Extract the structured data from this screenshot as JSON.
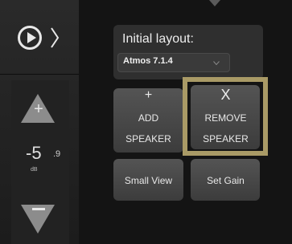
{
  "volume": {
    "value_main": "-5",
    "value_decimal": ".9",
    "unit": "dB",
    "up_icon": "plus-icon",
    "down_icon": "minus-icon"
  },
  "player": {
    "play_icon": "play-circle-icon",
    "chevron_icon": "chevron-right-icon"
  },
  "layout": {
    "label": "Initial layout:",
    "selected": "Atmos 7.1.4"
  },
  "buttons": {
    "add_symbol": "+",
    "add_line1": "ADD",
    "add_line2": "SPEAKER",
    "remove_symbol": "X",
    "remove_line1": "REMOVE",
    "remove_line2": "SPEAKER",
    "small_view": "Small View",
    "set_gain": "Set Gain"
  },
  "colors": {
    "highlight_frame": "#a99a66",
    "background": "#141414",
    "tile": "#4a4a4a"
  }
}
